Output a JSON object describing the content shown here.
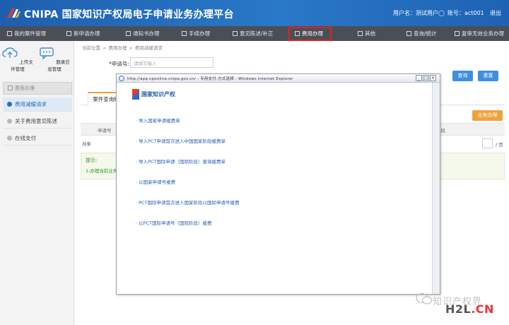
{
  "header": {
    "brand": "CNIPA 国家知识产权局电子申请业务办理平台",
    "user": "用户名：测试用户◯",
    "account": "账号：act001",
    "logout": "退出"
  },
  "nav": {
    "items": [
      {
        "label": "我的案件管理"
      },
      {
        "label": "新申请办理"
      },
      {
        "label": "通知书办理"
      },
      {
        "label": "手续办理"
      },
      {
        "label": "意见陈述/补正"
      },
      {
        "label": "费用办理",
        "active": true
      },
      {
        "label": "其他"
      },
      {
        "label": "查询/统计"
      },
      {
        "label": "复审无效业务办理"
      }
    ]
  },
  "sidebar": {
    "tools": [
      {
        "label": "上传文件管理",
        "icon": "cloud-upload-icon"
      },
      {
        "label": "题录信息管理",
        "icon": "chat-icon"
      }
    ],
    "group": "费用办理",
    "items": [
      {
        "label": "费用减缓请求",
        "active": true
      },
      {
        "label": "关于费用意见陈述"
      },
      {
        "label": "在线支付"
      }
    ]
  },
  "main": {
    "breadcrumb": [
      "当前位置",
      ">",
      "费用办理",
      ">",
      "费用减缓请求"
    ],
    "form_label": "*申请号:",
    "form_placeholder": "请填写输入",
    "query_button": "查询",
    "reset_button": "重置",
    "tab": "案件查询结",
    "business_button": "业务办理",
    "table_headers": [
      "申请号",
      "审查阶段"
    ],
    "total": "共条",
    "page_text": "/ 页",
    "tips_title": "提示:",
    "tips_text": "1.办理当前业务"
  },
  "popup": {
    "title": "http://app.cponline.cnipa.gov.cn/ - 专用支付-方式选择 - Windows Internet Explorer",
    "logo": "国家知识产权",
    "links": [
      "· 导入国家申请缓费单",
      "· 导入PCT申请首次进入中国国家阶段缓费单",
      "· 导入PCT国际申请（国际阶段）查询缓费单",
      "· 以国家申请号缓费",
      "· PCT国际申请首次进入国家阶段以国际申请号缓费",
      "· 以PCT国际申请号（国际阶段）缓费"
    ]
  },
  "watermark": {
    "text": "知识产权界",
    "site_left": "H2L",
    "site_right": ".CN"
  }
}
